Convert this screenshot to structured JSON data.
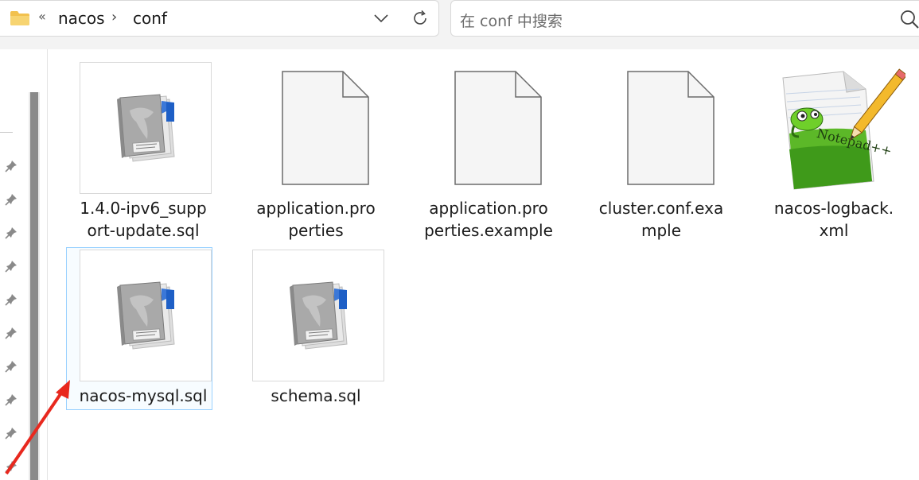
{
  "address_bar": {
    "overflow_chevron": "«",
    "breadcrumbs": [
      "nacos",
      "conf"
    ],
    "separator": "›"
  },
  "search": {
    "placeholder": "在 conf 中搜索"
  },
  "files": [
    {
      "name_lines": [
        "1.4.0-ipv6_supp",
        "ort-update.sql"
      ],
      "icon": "sql-file-icon"
    },
    {
      "name_lines": [
        "application.pro",
        "perties"
      ],
      "icon": "blank-file-icon"
    },
    {
      "name_lines": [
        "application.pro",
        "perties.example"
      ],
      "icon": "blank-file-icon"
    },
    {
      "name_lines": [
        "cluster.conf.exa",
        "mple"
      ],
      "icon": "blank-file-icon"
    },
    {
      "name_lines": [
        "nacos-logback.",
        "xml"
      ],
      "icon": "notepadpp-file-icon"
    },
    {
      "name_lines": [
        "nacos-mysql.sql"
      ],
      "icon": "sql-file-icon",
      "selected": true
    },
    {
      "name_lines": [
        "schema.sql"
      ],
      "icon": "sql-file-icon"
    }
  ],
  "colors": {
    "selection_border": "#99d1ff",
    "annotation_arrow": "#e8281e",
    "folder": "#f2c14e"
  }
}
